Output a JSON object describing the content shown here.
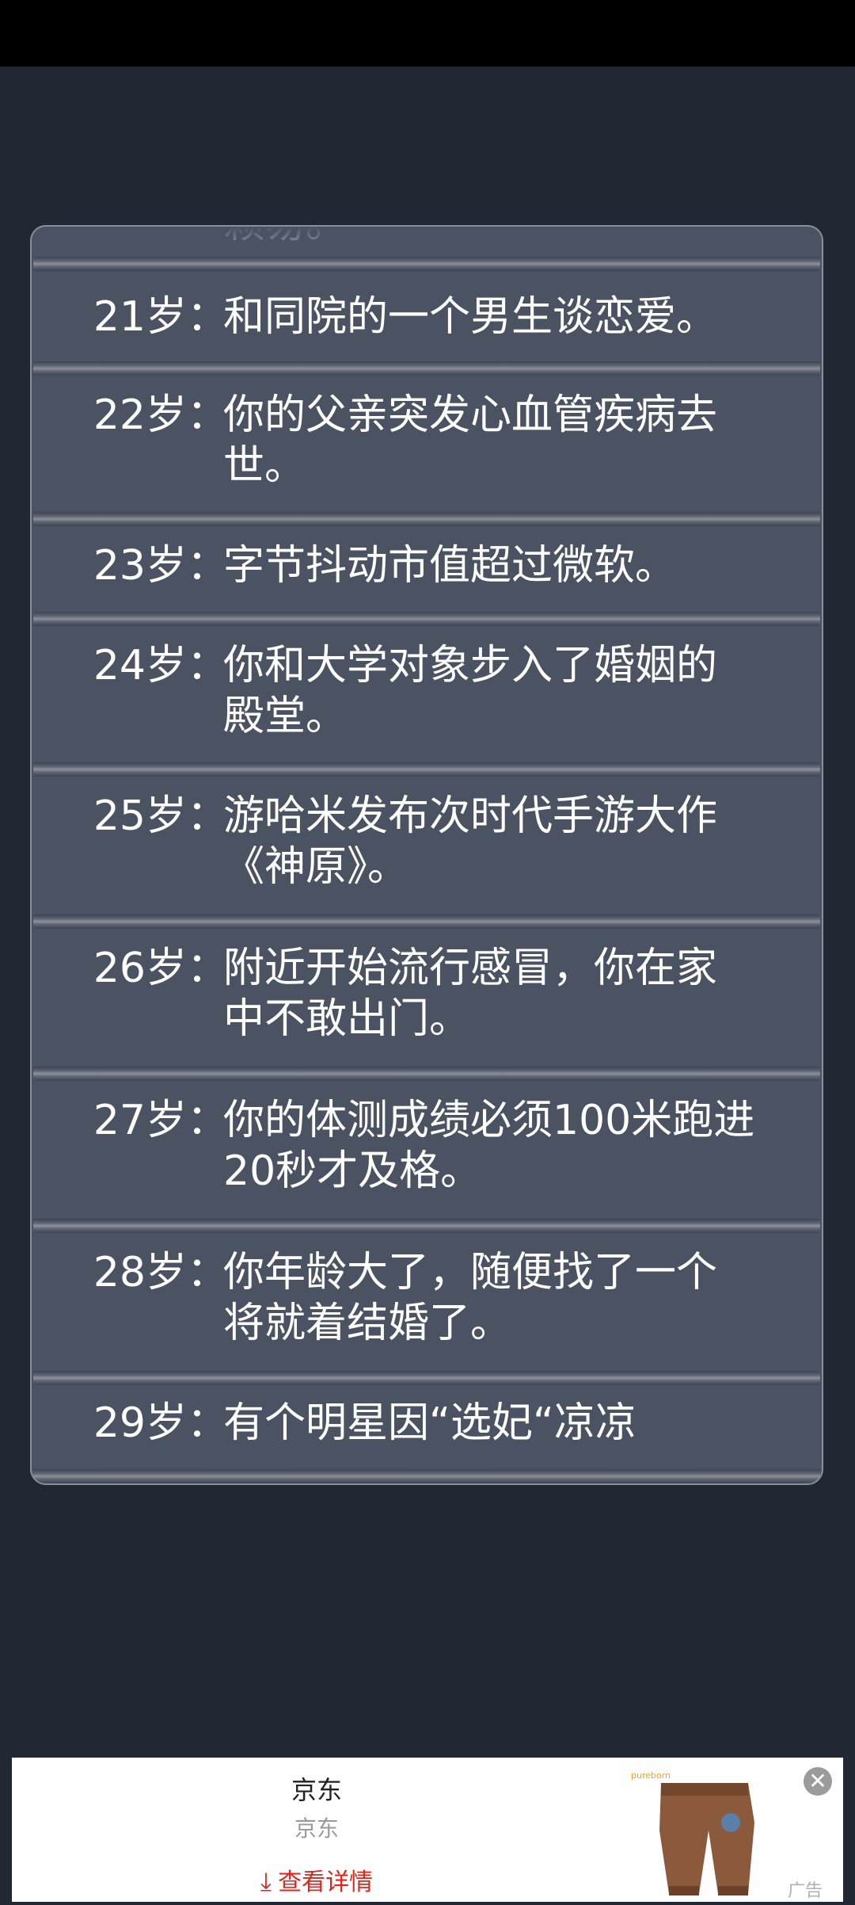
{
  "entries": [
    {
      "age": "",
      "lines": [
        "赖易。"
      ]
    },
    {
      "age": "21岁：",
      "lines": [
        "和同院的一个男生谈恋爱。"
      ]
    },
    {
      "age": "22岁：",
      "lines": [
        "你的父亲突发心血管疾病去",
        "世。"
      ]
    },
    {
      "age": "23岁：",
      "lines": [
        "字节抖动市值超过微软。"
      ]
    },
    {
      "age": "24岁：",
      "lines": [
        "你和大学对象步入了婚姻的",
        "殿堂。"
      ]
    },
    {
      "age": "25岁：",
      "lines": [
        "游哈米发布次时代手游大作",
        "《神原》。"
      ]
    },
    {
      "age": "26岁：",
      "lines": [
        "附近开始流行感冒，你在家",
        "中不敢出门。"
      ]
    },
    {
      "age": "27岁：",
      "lines": [
        "你的体测成绩必须100米跑进",
        "20秒才及格。"
      ]
    },
    {
      "age": "28岁：",
      "lines": [
        "你年龄大了，随便找了一个",
        "将就着结婚了。"
      ]
    },
    {
      "age": "29岁：",
      "lines": [
        "有个明星因“选妃“凉凉"
      ]
    }
  ],
  "ad": {
    "title": "京东",
    "subtitle": "京东",
    "link_label": "查看详情",
    "close_icon": "close-icon",
    "tag": "广告",
    "image_brand_text": "pureborn"
  },
  "colors": {
    "background": "#222833",
    "panel": "#4b5363",
    "link": "#e1251b"
  }
}
